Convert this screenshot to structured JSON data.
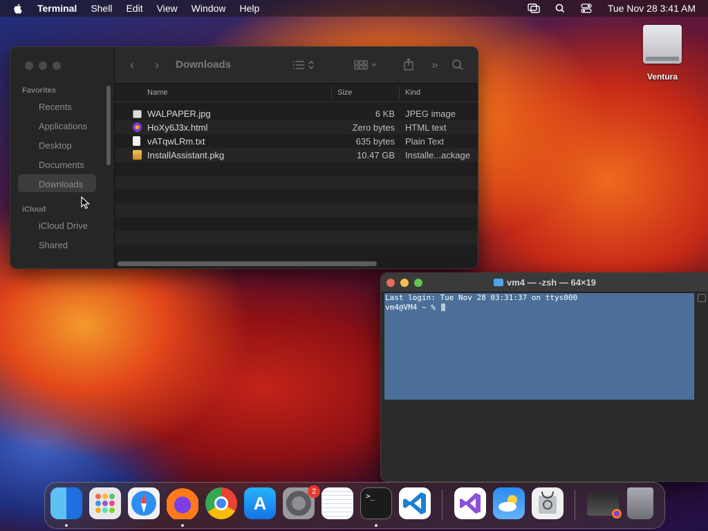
{
  "menubar": {
    "app_name": "Terminal",
    "menus": [
      "Shell",
      "Edit",
      "View",
      "Window",
      "Help"
    ],
    "clock": "Tue Nov 28  3:41 AM"
  },
  "desktop": {
    "drive_label": "Ventura"
  },
  "finder": {
    "title": "Downloads",
    "sidebar": {
      "favorites_header": "Favorites",
      "favorites": [
        "Recents",
        "Applications",
        "Desktop",
        "Documents",
        "Downloads"
      ],
      "selected": "Downloads",
      "icloud_header": "iCloud",
      "icloud": [
        "iCloud Drive",
        "Shared"
      ]
    },
    "columns": {
      "name": "Name",
      "size": "Size",
      "kind": "Kind"
    },
    "files": [
      {
        "name": "WALPAPER.jpg",
        "size": "6 KB",
        "kind": "JPEG image",
        "icon": "image-file-icon"
      },
      {
        "name": "HoXy6J3x.html",
        "size": "Zero bytes",
        "kind": "HTML text",
        "icon": "html-file-icon"
      },
      {
        "name": "vATqwLRm.txt",
        "size": "635 bytes",
        "kind": "Plain Text",
        "icon": "text-file-icon"
      },
      {
        "name": "InstallAssistant.pkg",
        "size": "10.47 GB",
        "kind": "Installe...ackage",
        "icon": "package-file-icon"
      }
    ]
  },
  "terminal": {
    "title": "vm4 — -zsh — 64×19",
    "lines": [
      "Last login: Tue Nov 28 03:31:37 on ttys000",
      "vm4@VM4 ~ % "
    ]
  },
  "dock": {
    "apps": [
      "Finder",
      "Launchpad",
      "Safari",
      "Firefox",
      "Chrome",
      "App Store",
      "System Settings",
      "TextEdit",
      "Terminal",
      "Visual Studio Code",
      "Visual Studio",
      "Weather",
      "Disk Utility",
      "Downloads Stack",
      "Trash"
    ],
    "settings_badge": "2"
  },
  "colors": {
    "terminal_selection": "#4b6f98",
    "close": "#ed6a5e",
    "minimize": "#f5bf4f",
    "zoom": "#61c554"
  }
}
